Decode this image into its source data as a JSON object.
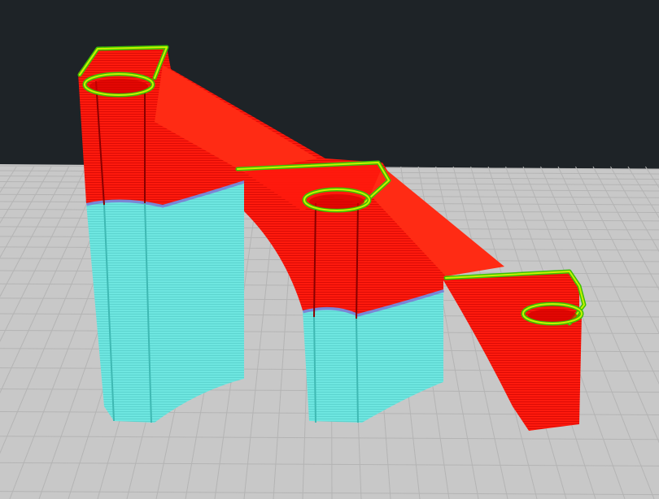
{
  "viewport": {
    "background_color": "#1e2327",
    "build_plate_color": "#c8c8c8",
    "grid_line_color": "#b4b4b4"
  },
  "model": {
    "shell_color": "#ff1a0d",
    "layer_line_color": "#b80000",
    "support_color": "#6ee6e0",
    "interface_color": "#7a86d6",
    "top_edge_color": "#c8f000",
    "top_edge_outline_color": "#3bc000"
  }
}
